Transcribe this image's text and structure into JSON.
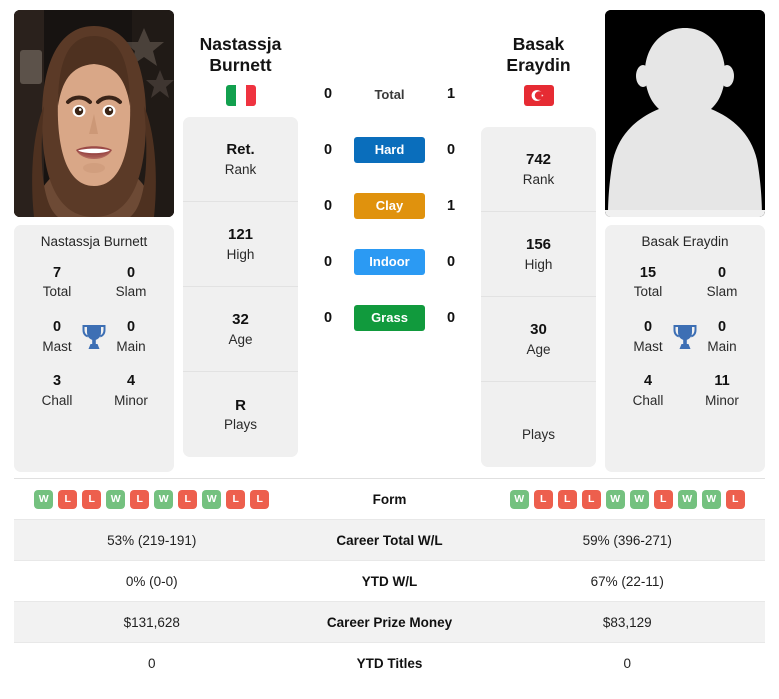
{
  "players": {
    "left": {
      "name": "Nastassja Burnett",
      "first_name": "Nastassja",
      "last_name": "Burnett",
      "country": "Italy",
      "flag_icon": "flag-italy-icon",
      "photo_alt": "photo of Nastassja Burnett",
      "rank": "Ret.",
      "rank_label": "Rank",
      "high": "121",
      "high_label": "High",
      "age": "32",
      "age_label": "Age",
      "plays": "R",
      "plays_label": "Plays",
      "titles": {
        "total": "7",
        "total_label": "Total",
        "slam": "0",
        "slam_label": "Slam",
        "mast": "0",
        "mast_label": "Mast",
        "main": "0",
        "main_label": "Main",
        "chall": "3",
        "chall_label": "Chall",
        "minor": "4",
        "minor_label": "Minor"
      },
      "form": [
        "W",
        "L",
        "L",
        "W",
        "L",
        "W",
        "L",
        "W",
        "L",
        "L"
      ],
      "career_total_wl": "53% (219-191)",
      "ytd_wl": "0% (0-0)",
      "career_prize_money": "$131,628",
      "ytd_titles": "0"
    },
    "right": {
      "name": "Basak Eraydin",
      "first_name": "Basak",
      "last_name": "Eraydin",
      "country": "Turkey",
      "flag_icon": "flag-turkey-icon",
      "photo_alt": "placeholder silhouette for Basak Eraydin",
      "rank": "742",
      "rank_label": "Rank",
      "high": "156",
      "high_label": "High",
      "age": "30",
      "age_label": "Age",
      "plays": "",
      "plays_label": "Plays",
      "titles": {
        "total": "15",
        "total_label": "Total",
        "slam": "0",
        "slam_label": "Slam",
        "mast": "0",
        "mast_label": "Mast",
        "main": "0",
        "main_label": "Main",
        "chall": "4",
        "chall_label": "Chall",
        "minor": "11",
        "minor_label": "Minor"
      },
      "form": [
        "W",
        "L",
        "L",
        "L",
        "W",
        "W",
        "L",
        "W",
        "W",
        "L"
      ],
      "career_total_wl": "59% (396-271)",
      "ytd_wl": "67% (22-11)",
      "career_prize_money": "$83,129",
      "ytd_titles": "0"
    }
  },
  "h2h": {
    "rows": [
      {
        "label": "Total",
        "left": "0",
        "right": "1",
        "style": "plain",
        "color": ""
      },
      {
        "label": "Hard",
        "left": "0",
        "right": "0",
        "style": "bar",
        "color": "#0a6ebc"
      },
      {
        "label": "Clay",
        "left": "0",
        "right": "1",
        "style": "bar",
        "color": "#e0920d"
      },
      {
        "label": "Indoor",
        "left": "0",
        "right": "0",
        "style": "bar",
        "color": "#2b9af3"
      },
      {
        "label": "Grass",
        "left": "0",
        "right": "0",
        "style": "bar",
        "color": "#119a3d"
      }
    ]
  },
  "table": {
    "rows": [
      {
        "label": "Form",
        "left": "",
        "right": "",
        "type": "form"
      },
      {
        "label": "Career Total W/L",
        "left": "53% (219-191)",
        "right": "59% (396-271)",
        "type": "text"
      },
      {
        "label": "YTD W/L",
        "left": "0% (0-0)",
        "right": "67% (22-11)",
        "type": "text"
      },
      {
        "label": "Career Prize Money",
        "left": "$131,628",
        "right": "$83,129",
        "type": "text"
      },
      {
        "label": "YTD Titles",
        "left": "0",
        "right": "0",
        "type": "text"
      }
    ]
  },
  "colors": {
    "win": "#74c17f",
    "loss": "#ed5f4d",
    "trophy": "#3d6fb4",
    "card_bg": "#f0f0f0",
    "row_alt_bg": "#f2f2f2"
  }
}
